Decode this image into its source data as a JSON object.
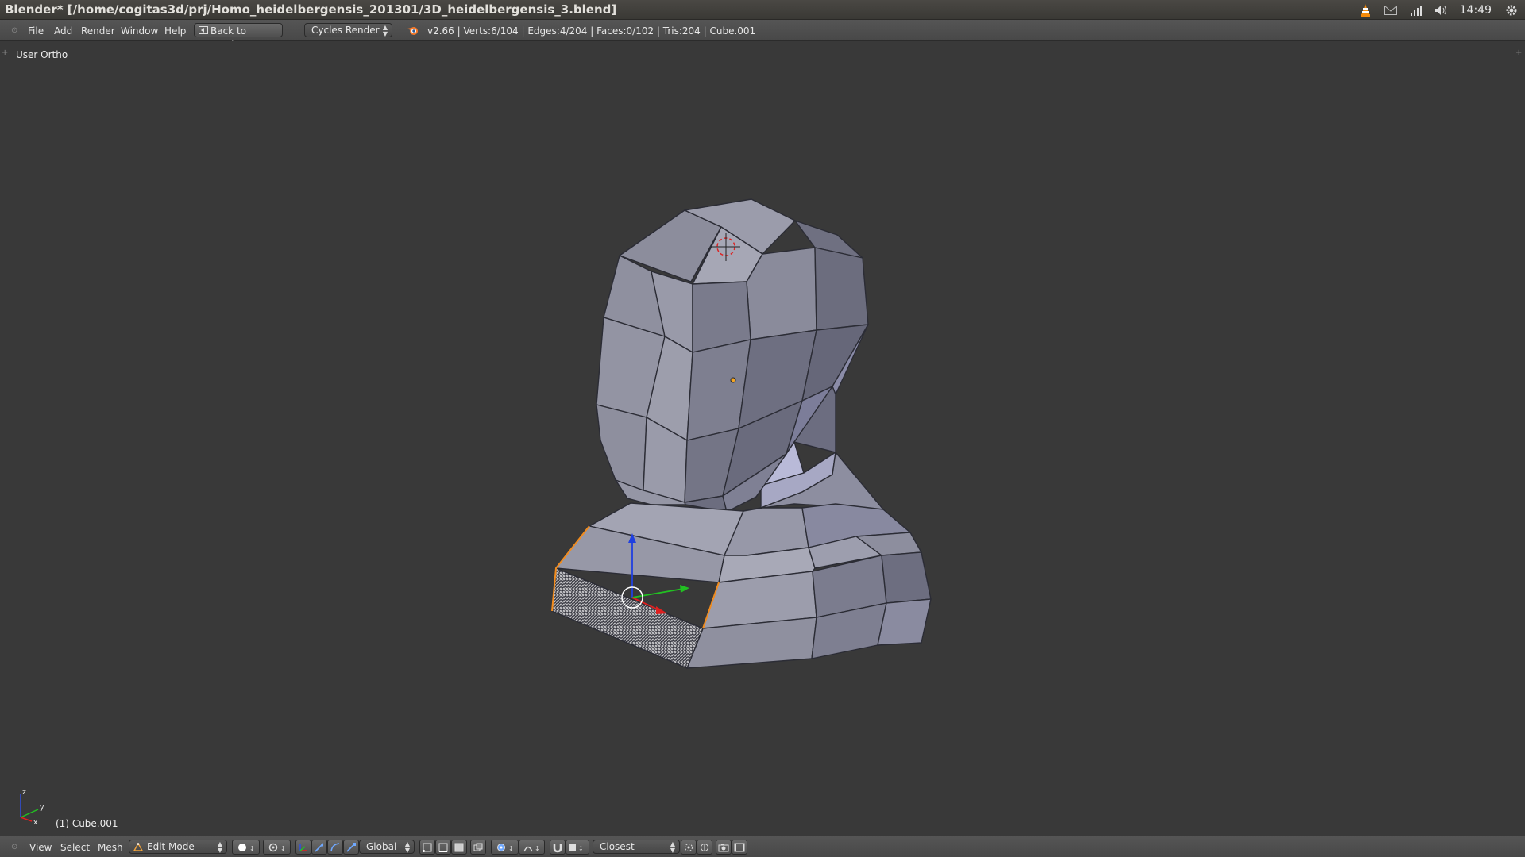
{
  "window": {
    "title": "Blender* [/home/cogitas3d/prj/Homo_heidelbergensis_201301/3D_heidelbergensis_3.blend]"
  },
  "tray": {
    "clock": "14:49",
    "icons": [
      "vlc-icon",
      "mail-icon",
      "network-icon",
      "volume-icon",
      "settings-gear-icon"
    ]
  },
  "header": {
    "menus": [
      "File",
      "Add",
      "Render",
      "Window",
      "Help"
    ],
    "back_button": "Back to Previous",
    "render_engine": "Cycles Render",
    "stats": "v2.66 | Verts:6/104 | Edges:4/204 | Faces:0/102 | Tris:204 | Cube.001"
  },
  "viewport": {
    "view_label": "User Ortho",
    "object_label": "(1) Cube.001",
    "axis_labels": {
      "x": "x",
      "y": "y",
      "z": "z"
    }
  },
  "footer": {
    "menus": [
      "View",
      "Select",
      "Mesh"
    ],
    "mode": "Edit Mode",
    "orientation": "Global",
    "snap_target": "Closest"
  },
  "colors": {
    "selection": "#f28c1e",
    "manip_x": "#e02020",
    "manip_y": "#22c022",
    "manip_z": "#2040e0"
  }
}
